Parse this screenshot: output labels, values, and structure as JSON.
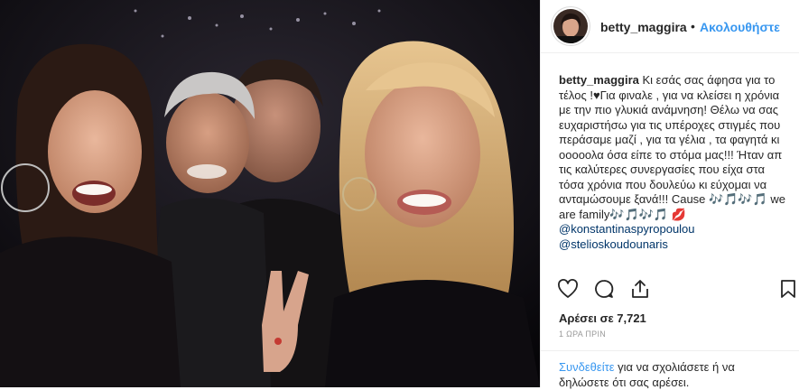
{
  "post": {
    "username": "betty_maggira",
    "dot": "•",
    "follow_label": "Ακολουθήστε",
    "caption_user": "betty_maggira",
    "caption_text": "Κι εσάς σας άφησα για το τέλος !♥Για φιναλε , για να κλείσει η χρόνια με την πιο γλυκιά ανάμνηση! Θέλω να σας ευχαριστήσω για τις υπέροχες στιγμές που περάσαμε μαζί , για τα γέλια , τα φαγητά κι οοοοολα όσα είπε το στόμα μας!!! Ήταν απ τις καλύτερες συνεργασίες που είχα στα τόσα χρόνια που δουλεύω κι εύχομαι να ανταμώσουμε ξανά!!! Cause 🎶🎵🎶🎵 we are family🎶🎵🎶🎵 💋",
    "mentions": [
      "@konstantinaspyropoulou",
      "@stelioskoudounaris"
    ],
    "likes": "Αρέσει σε 7,721",
    "time": "1 ΩΡΑ ΠΡΙΝ",
    "login_link": "Συνδεθείτε",
    "login_text": " για να σχολιάσετε ή να δηλώσετε ότι σας αρέσει."
  },
  "icons": {
    "like": "heart-icon",
    "comment": "comment-icon",
    "share": "share-icon",
    "save": "bookmark-icon"
  },
  "colors": {
    "link_blue": "#3897f0",
    "mention_blue": "#003569",
    "text": "#262626",
    "muted": "#999999"
  }
}
